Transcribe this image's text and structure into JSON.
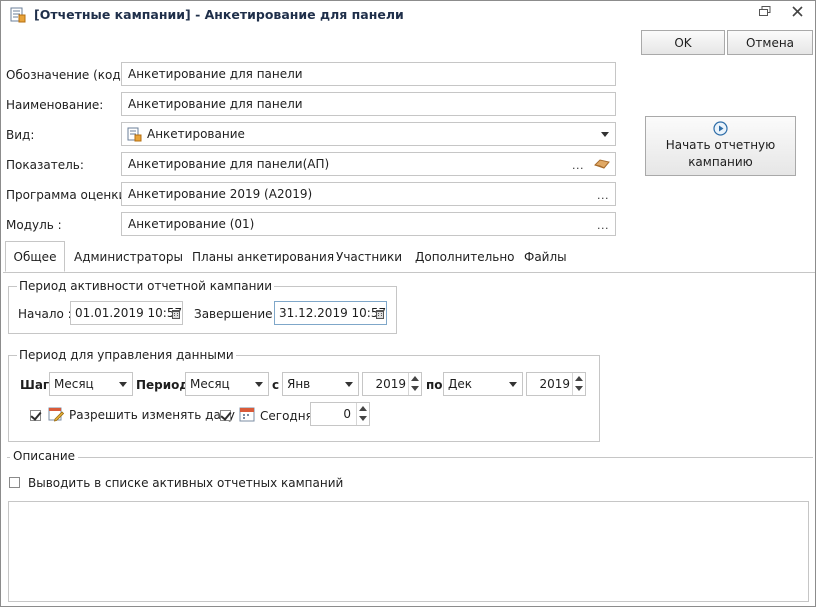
{
  "window": {
    "title": "[Отчетные кампании] - Анкетирование для панели"
  },
  "buttons": {
    "ok": "OK",
    "cancel": "Отмена",
    "start_line1": "Начать отчетную",
    "start_line2": "кампанию"
  },
  "form": {
    "code_label": "Обозначение (код):",
    "code_value": "Анкетирование для панели",
    "name_label": "Наименование:",
    "name_value": "Анкетирование для панели",
    "kind_label": "Вид:",
    "kind_value": "Анкетирование",
    "indicator_label": "Показатель:",
    "indicator_value": "Анкетирование для панели(АП)",
    "program_label": "Программа оценки :",
    "program_value": "Анкетирование 2019 (А2019)",
    "module_label": "Модуль :",
    "module_value": "Анкетирование (01)",
    "ellipsis": "..."
  },
  "tabs": [
    "Общее",
    "Администраторы",
    "Планы анкетирования",
    "Участники",
    "Дополнительно",
    "Файлы"
  ],
  "activity": {
    "legend": "Период активности отчетной кампании",
    "start_label": "Начало :",
    "start_value": "01.01.2019 10:57",
    "end_label": "Завершение :",
    "end_value": "31.12.2019 10:57"
  },
  "data_period": {
    "legend": "Период для управления данными",
    "step_label": "Шаг:",
    "step_value": "Месяц",
    "period_label": "Период:",
    "period_value": "Месяц",
    "from_label": "с",
    "from_month": "Янв",
    "from_year": "2019",
    "to_label": "по",
    "to_month": "Дек",
    "to_year": "2019",
    "allow_change_label": "Разрешить изменять дату",
    "today_label": "Сегодня",
    "today_value": "0"
  },
  "description": {
    "legend": "Описание",
    "show_active_label": "Выводить в списке активных отчетных кампаний"
  },
  "colors": {
    "title": "#1f2f4a",
    "border": "#c6c6c6",
    "focus_border": "#7fa7c9"
  }
}
